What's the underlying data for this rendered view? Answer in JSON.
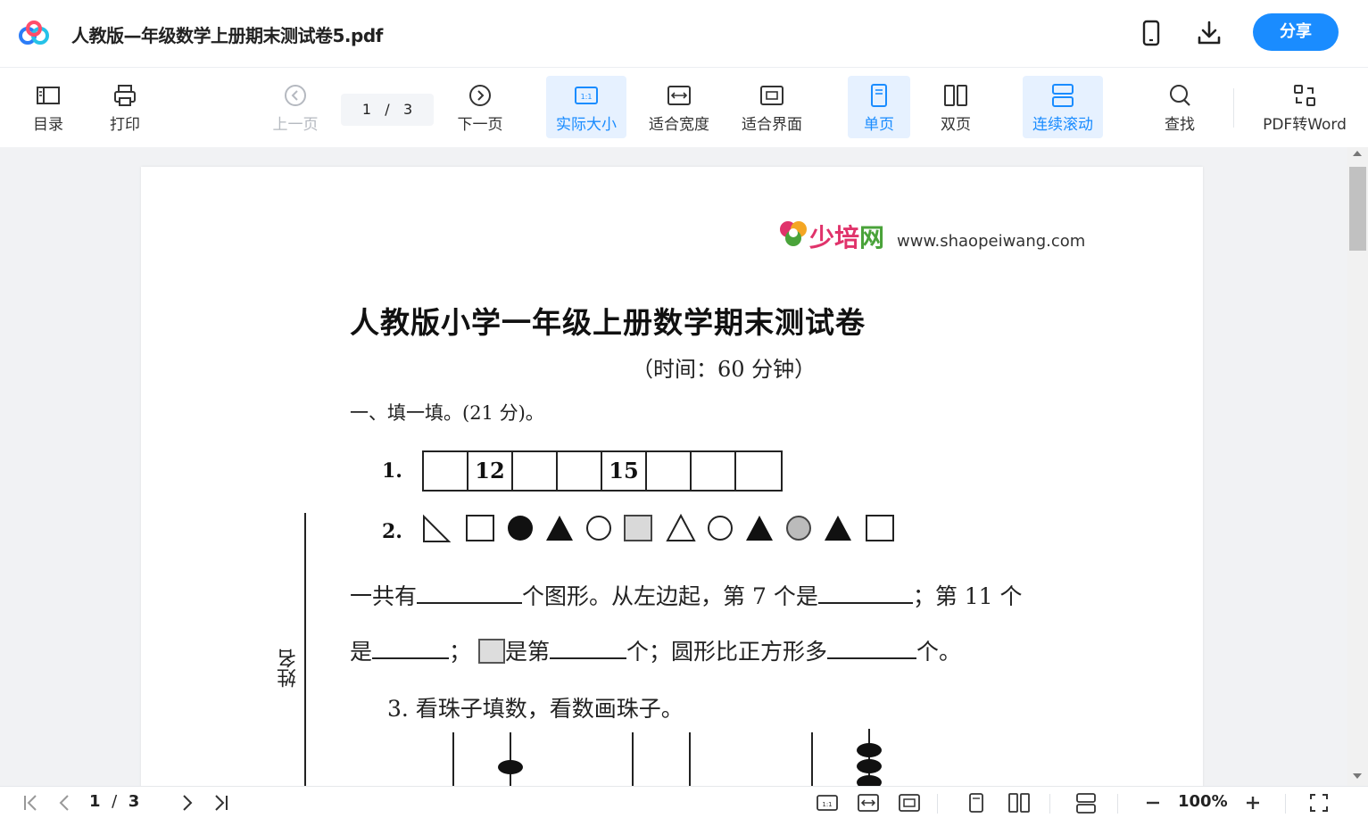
{
  "header": {
    "doc_title": "人教版—年级数学上册期末测试卷5.pdf",
    "share_label": "分享",
    "icons": [
      "app-logo-icon",
      "phone-icon",
      "download-icon"
    ]
  },
  "toolbar": {
    "toc_label": "目录",
    "print_label": "打印",
    "prev_label": "上一页",
    "page_current": "1",
    "page_sep": "/",
    "page_total": "3",
    "next_label": "下一页",
    "actual_size_label": "实际大小",
    "fit_width_label": "适合宽度",
    "fit_page_label": "适合界面",
    "single_label": "单页",
    "double_label": "双页",
    "continuous_label": "连续滚动",
    "search_label": "查找",
    "pdf2word_label": "PDF转Word",
    "accent_color": "#1a8cff",
    "active_bg": "#e6f1ff"
  },
  "document": {
    "brand_name_1": "少",
    "brand_name_2": "培",
    "brand_name_3": "网",
    "brand_url": "www.shaopeiwang.com",
    "title": "人教版小学一年级上册数学期末测试卷",
    "subtitle": "（时间：60 分钟）",
    "section1": "一、填一填。(21 分)。",
    "q1_label": "1.",
    "q1_cells": [
      "",
      "12",
      "",
      "",
      "15",
      "",
      "",
      ""
    ],
    "q2_label": "2.",
    "q2_line1_a": "一共有",
    "q2_line1_b": "个图形。从左边起，第  7  个是",
    "q2_line1_c": "；第  11  个",
    "q2_line2_a": "是",
    "q2_line2_b": "；",
    "q2_line2_c": "是第",
    "q2_line2_d": "个；圆形比正方形多",
    "q2_line2_e": "个。",
    "q3": "3. 看珠子填数，看数画珠子。",
    "name_label": "姓名"
  },
  "bottombar": {
    "page_current": "1",
    "page_sep": "/",
    "page_total": "3",
    "zoom": "100%"
  }
}
